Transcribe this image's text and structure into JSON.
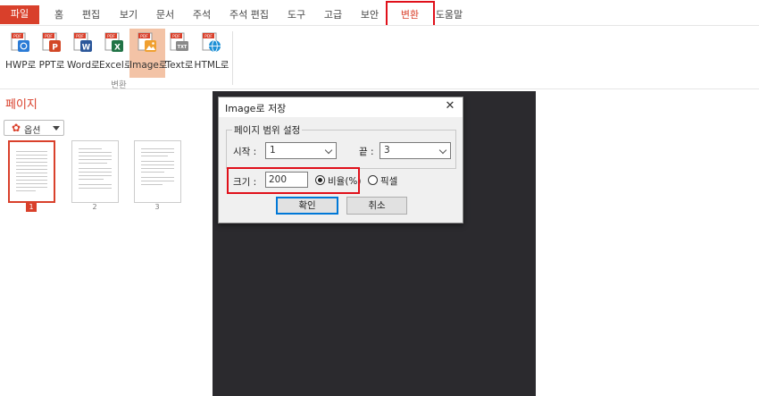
{
  "menu": {
    "file": "파일",
    "tabs": [
      "홈",
      "편집",
      "보기",
      "문서",
      "주석",
      "주석 편집",
      "도구",
      "고급",
      "보안",
      "변환",
      "도움말"
    ],
    "active_tab": "변환"
  },
  "ribbon": {
    "buttons": [
      {
        "label": "HWP로",
        "badge": "",
        "icon": "hwp-file-icon",
        "color": "#2b7bd6"
      },
      {
        "label": "PPT로",
        "badge": "P",
        "icon": "ppt-file-icon",
        "color": "#d24726"
      },
      {
        "label": "Word로",
        "badge": "W",
        "icon": "word-file-icon",
        "color": "#2b579a"
      },
      {
        "label": "Excel로",
        "badge": "X",
        "icon": "excel-file-icon",
        "color": "#217346"
      },
      {
        "label": "Image로",
        "badge": "",
        "icon": "image-file-icon",
        "color": "#f0a030"
      },
      {
        "label": "Text로",
        "badge": "TXT",
        "icon": "text-file-icon",
        "color": "#8a8a8a"
      },
      {
        "label": "HTML로",
        "badge": "",
        "icon": "html-file-icon",
        "color": "#1e90d6"
      }
    ],
    "active_button": "Image로",
    "pdf_badge": "PDF",
    "group_label": "변환"
  },
  "pages_panel": {
    "title": "페이지",
    "options_label": "옵션",
    "pages": [
      "1",
      "2",
      "3"
    ],
    "selected_page": "1"
  },
  "dialog": {
    "title": "Image로 저장",
    "range_legend": "페이지 범위 설정",
    "start_label": "시작 :",
    "start_value": "1",
    "end_label": "끝 :",
    "end_value": "3",
    "size_label": "크기 :",
    "size_value": "200",
    "radio_ratio": "비율(%)",
    "radio_pixel": "픽셀",
    "ok_label": "확인",
    "cancel_label": "취소",
    "close_glyph": "✕"
  },
  "colors": {
    "accent": "#d9402b",
    "highlight": "#e0101a",
    "doc_background": "#2b2a2e"
  }
}
